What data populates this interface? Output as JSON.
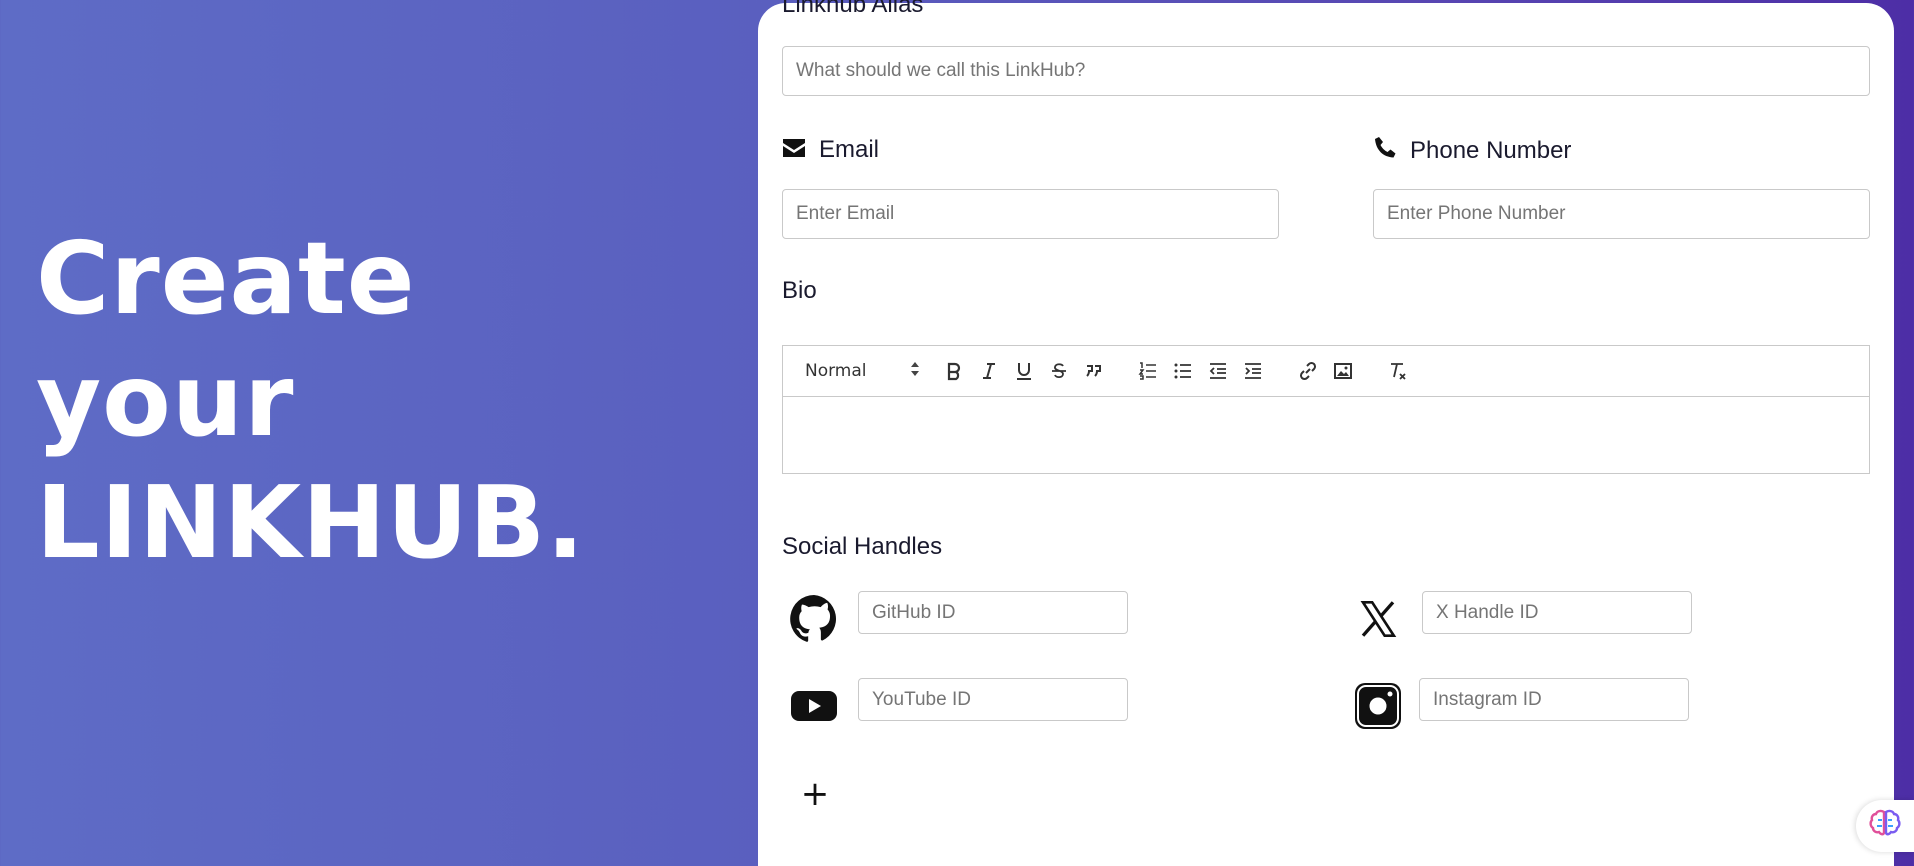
{
  "hero": {
    "line1": "Create",
    "line2": "your",
    "line3": "LINKHUB."
  },
  "form": {
    "alias_label": "Linkhub Alias",
    "alias_placeholder": "What should we call this LinkHub?",
    "email_label": "Email",
    "email_placeholder": "Enter Email",
    "phone_label": "Phone Number",
    "phone_placeholder": "Enter Phone Number",
    "bio_label": "Bio",
    "bio_format": "Normal",
    "social_label": "Social Handles",
    "github_placeholder": "GitHub ID",
    "x_placeholder": "X Handle ID",
    "youtube_placeholder": "YouTube ID",
    "instagram_placeholder": "Instagram ID",
    "add_label": "+"
  },
  "toolbar_icons": [
    "bold-icon",
    "italic-icon",
    "underline-icon",
    "strike-icon",
    "blockquote-icon",
    "ordered-list-icon",
    "bullet-list-icon",
    "outdent-icon",
    "indent-icon",
    "link-icon",
    "image-icon",
    "clear-format-icon"
  ],
  "colors": {
    "accent_start": "#5e6cc6",
    "accent_end": "#4d2ea6"
  }
}
